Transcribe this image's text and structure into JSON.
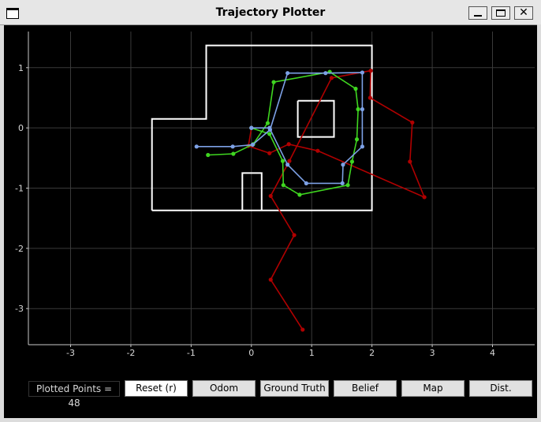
{
  "window": {
    "title": "Trajectory Plotter"
  },
  "icons": {
    "app": "window-icon",
    "minimize": "minimize-icon",
    "maximize": "maximize-icon",
    "close": "close-icon"
  },
  "controls": {
    "counter": "Plotted Points = 48",
    "buttons": [
      "Reset (r)",
      "Odom",
      "Ground Truth",
      "Belief",
      "Map",
      "Dist."
    ]
  },
  "colors": {
    "background": "#000000",
    "map": "#ffffff",
    "odom": "#b00000",
    "ground_truth": "#3fd620",
    "belief": "#7da1e6",
    "grid": "#3a3a3a"
  },
  "chart_data": {
    "type": "line",
    "title": "",
    "xlabel": "",
    "ylabel": "",
    "xlim": [
      -3.7,
      4.7
    ],
    "ylim": [
      -3.6,
      1.6
    ],
    "xticks": [
      "-3",
      "-2",
      "-1",
      "0",
      "1",
      "2",
      "3",
      "4"
    ],
    "yticks": [
      "1",
      "0",
      "-1",
      "-2",
      "-3"
    ],
    "grid": true,
    "map": {
      "walls": [
        [
          [
            -1.65,
            -1.37
          ],
          [
            2.0,
            -1.37
          ],
          [
            2.0,
            1.37
          ],
          [
            -0.75,
            1.37
          ],
          [
            -0.75,
            0.15
          ],
          [
            -1.65,
            0.15
          ],
          [
            -1.65,
            -1.37
          ]
        ],
        [
          [
            0.77,
            0.45
          ],
          [
            1.37,
            0.45
          ],
          [
            1.37,
            -0.15
          ],
          [
            0.77,
            -0.15
          ],
          [
            0.77,
            0.45
          ]
        ],
        [
          [
            -0.15,
            -1.37
          ],
          [
            -0.15,
            -0.75
          ],
          [
            0.17,
            -0.75
          ],
          [
            0.17,
            -1.37
          ]
        ]
      ]
    },
    "series": [
      {
        "key": "odom",
        "points": [
          [
            0.85,
            -3.35
          ],
          [
            0.32,
            -2.52
          ],
          [
            0.71,
            -1.78
          ],
          [
            0.32,
            -1.13
          ],
          [
            0.63,
            -0.55
          ],
          [
            1.33,
            0.83
          ],
          [
            1.98,
            0.95
          ],
          [
            1.97,
            0.5
          ],
          [
            2.67,
            0.09
          ],
          [
            2.63,
            -0.56
          ],
          [
            2.87,
            -1.15
          ],
          [
            1.1,
            -0.38
          ],
          [
            0.62,
            -0.27
          ],
          [
            0.3,
            -0.42
          ],
          [
            -0.05,
            -0.3
          ],
          [
            0.0,
            0.0
          ]
        ]
      },
      {
        "key": "ground_truth",
        "points": [
          [
            -0.72,
            -0.45
          ],
          [
            -0.3,
            -0.43
          ],
          [
            0.03,
            -0.27
          ],
          [
            0.27,
            0.08
          ],
          [
            0.37,
            0.76
          ],
          [
            1.3,
            0.93
          ],
          [
            1.73,
            0.65
          ],
          [
            1.77,
            0.31
          ],
          [
            1.75,
            -0.19
          ],
          [
            1.67,
            -0.56
          ],
          [
            1.6,
            -0.95
          ],
          [
            0.8,
            -1.11
          ],
          [
            0.53,
            -0.95
          ],
          [
            0.52,
            -0.55
          ],
          [
            0.3,
            -0.1
          ],
          [
            0.0,
            0.0
          ]
        ]
      },
      {
        "key": "belief",
        "points": [
          [
            -0.91,
            -0.31
          ],
          [
            -0.31,
            -0.31
          ],
          [
            0.02,
            -0.28
          ],
          [
            0.31,
            -0.03
          ],
          [
            0.6,
            0.91
          ],
          [
            1.23,
            0.91
          ],
          [
            1.84,
            0.92
          ],
          [
            1.84,
            0.31
          ],
          [
            1.84,
            -0.31
          ],
          [
            1.52,
            -0.61
          ],
          [
            1.51,
            -0.92
          ],
          [
            0.91,
            -0.92
          ],
          [
            0.6,
            -0.61
          ],
          [
            0.3,
            0.0
          ],
          [
            0.0,
            0.0
          ],
          [
            0.0,
            0.0
          ]
        ]
      }
    ]
  }
}
